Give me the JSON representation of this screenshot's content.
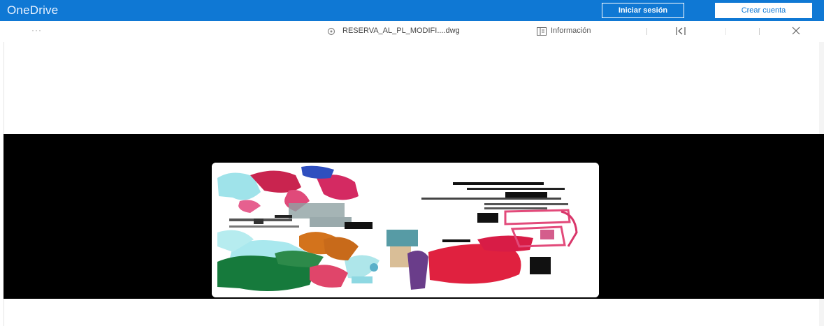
{
  "header": {
    "brand": "OneDrive",
    "signin_label": "Iniciar sesión",
    "create_account_label": "Crear cuenta",
    "brand_color": "#0f78d4"
  },
  "toolbar": {
    "more_label": "···",
    "file_name": "RESERVA_AL_PL_MODIFI....dwg",
    "info_label": "Información"
  },
  "preview": {
    "background": "#000000"
  }
}
